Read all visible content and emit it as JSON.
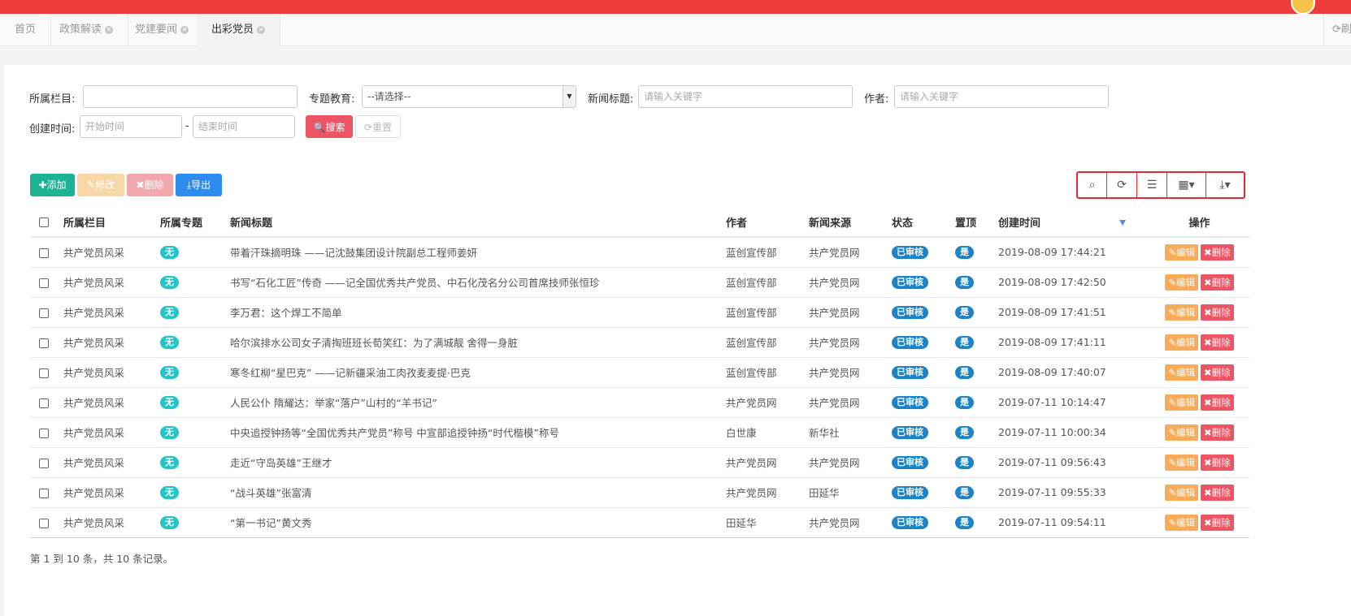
{
  "tabs": [
    {
      "label": "首页",
      "closable": false,
      "active": false
    },
    {
      "label": "政策解读",
      "closable": true,
      "active": false
    },
    {
      "label": "党建要闻",
      "closable": true,
      "active": false
    },
    {
      "label": "出彩党员",
      "closable": true,
      "active": true
    }
  ],
  "refresh_label": "刷新",
  "filters": {
    "column_label": "所属栏目:",
    "column_value": "",
    "topic_label": "专题教育:",
    "topic_value": "--请选择--",
    "title_label": "新闻标题:",
    "title_placeholder": "请输入关键字",
    "author_label": "作者:",
    "author_placeholder": "请输入关键字",
    "created_label": "创建时间:",
    "start_placeholder": "开始时间",
    "dash": "-",
    "end_placeholder": "结束时间",
    "search_label": "搜索",
    "reset_label": "重置"
  },
  "toolbar": {
    "add_label": "添加",
    "edit_label": "修改",
    "delete_label": "删除",
    "export_label": "导出",
    "icons": [
      "search-icon",
      "refresh-icon",
      "list-view-icon",
      "columns-icon",
      "export-icon"
    ]
  },
  "table": {
    "headers": [
      "所属栏目",
      "所属专题",
      "新闻标题",
      "作者",
      "新闻来源",
      "状态",
      "置顶",
      "创建时间",
      "操作"
    ],
    "rows": [
      {
        "column": "共产党员风采",
        "topic": "无",
        "title": "带着汗珠摘明珠 ——记沈鼓集团设计院副总工程师姜妍",
        "author": "蓝创宣传部",
        "source": "共产党员网",
        "status": "已审核",
        "top": "是",
        "created": "2019-08-09 17:44:21"
      },
      {
        "column": "共产党员风采",
        "topic": "无",
        "title": "书写“石化工匠”传奇 ——记全国优秀共产党员、中石化茂名分公司首席技师张恒珍",
        "author": "蓝创宣传部",
        "source": "共产党员网",
        "status": "已审核",
        "top": "是",
        "created": "2019-08-09 17:42:50"
      },
      {
        "column": "共产党员风采",
        "topic": "无",
        "title": "李万君：这个焊工不简单",
        "author": "蓝创宣传部",
        "source": "共产党员网",
        "status": "已审核",
        "top": "是",
        "created": "2019-08-09 17:41:51"
      },
      {
        "column": "共产党员风采",
        "topic": "无",
        "title": "哈尔滨排水公司女子清掏班班长荀笑红：为了满城靓 舍得一身脏",
        "author": "蓝创宣传部",
        "source": "共产党员网",
        "status": "已审核",
        "top": "是",
        "created": "2019-08-09 17:41:11"
      },
      {
        "column": "共产党员风采",
        "topic": "无",
        "title": "寒冬红柳“星巴克” ——记新疆采油工肉孜麦麦提·巴克",
        "author": "蓝创宣传部",
        "source": "共产党员网",
        "status": "已审核",
        "top": "是",
        "created": "2019-08-09 17:40:07"
      },
      {
        "column": "共产党员风采",
        "topic": "无",
        "title": "人民公仆 隋耀达：举家“落户”山村的“羊书记”",
        "author": "共产党员网",
        "source": "共产党员网",
        "status": "已审核",
        "top": "是",
        "created": "2019-07-11 10:14:47"
      },
      {
        "column": "共产党员风采",
        "topic": "无",
        "title": "中央追授钟扬等“全国优秀共产党员”称号 中宣部追授钟扬“时代楷模”称号",
        "author": "白世康",
        "source": "新华社",
        "status": "已审核",
        "top": "是",
        "created": "2019-07-11 10:00:34"
      },
      {
        "column": "共产党员风采",
        "topic": "无",
        "title": "走近“守岛英雄”王继才",
        "author": "共产党员网",
        "source": "共产党员网",
        "status": "已审核",
        "top": "是",
        "created": "2019-07-11 09:56:43"
      },
      {
        "column": "共产党员风采",
        "topic": "无",
        "title": "“战斗英雄”张富清",
        "author": "共产党员网",
        "source": "田延华",
        "status": "已审核",
        "top": "是",
        "created": "2019-07-11 09:55:33"
      },
      {
        "column": "共产党员风采",
        "topic": "无",
        "title": "“第一书记”黄文秀",
        "author": "田延华",
        "source": "共产党员网",
        "status": "已审核",
        "top": "是",
        "created": "2019-07-11 09:54:11"
      }
    ],
    "row_edit_label": "编辑",
    "row_delete_label": "删除"
  },
  "footer_text": "第 1 到 10 条，共 10 条记录。"
}
